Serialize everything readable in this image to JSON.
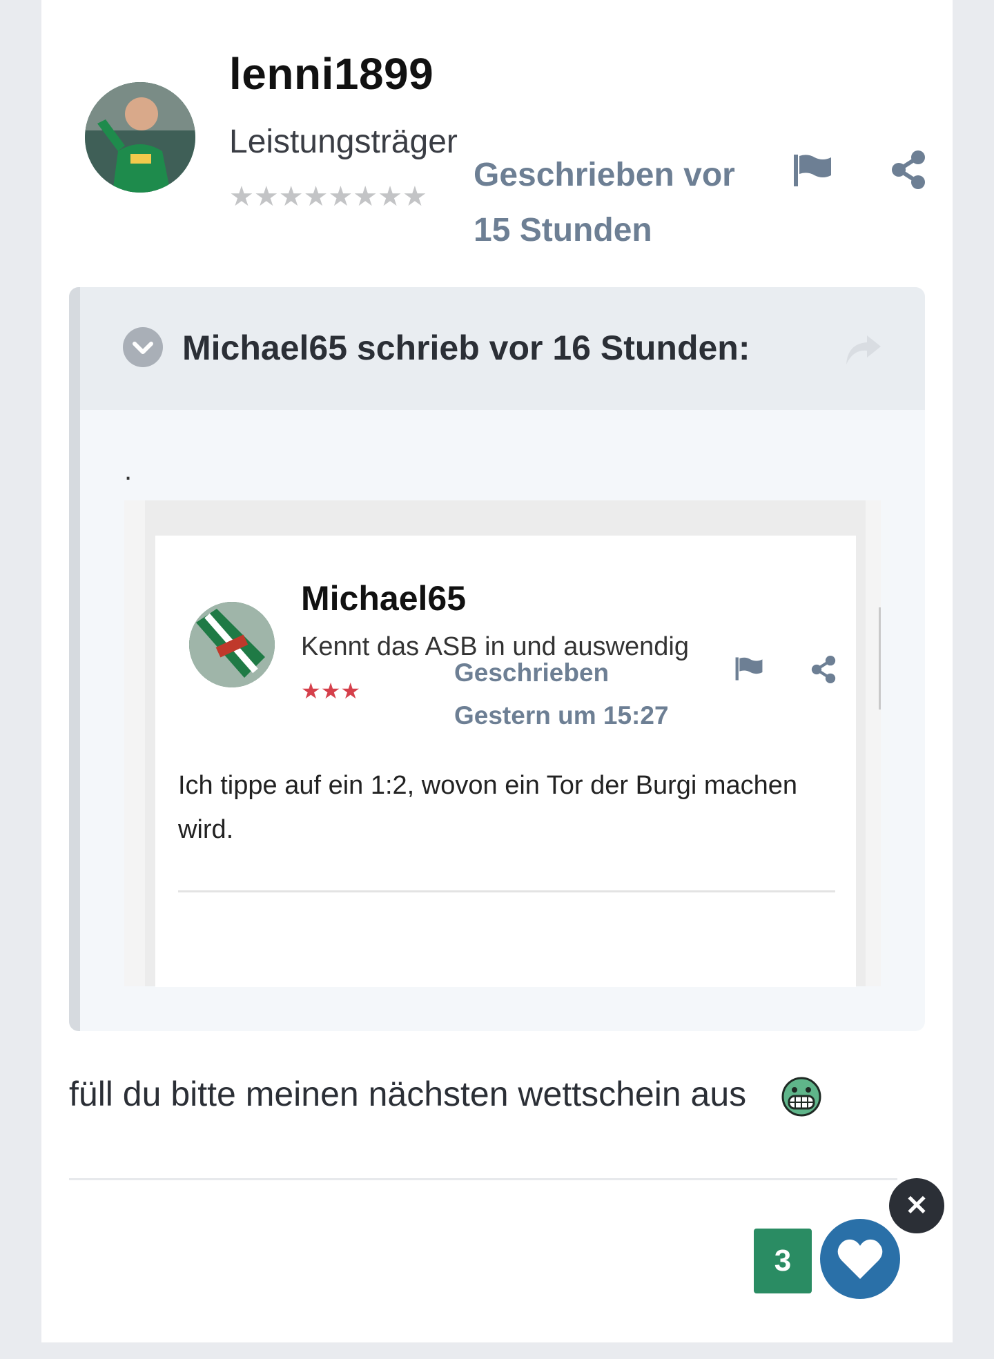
{
  "post": {
    "author": "lenni1899",
    "rank": "Leistungsträger",
    "rank_stars": "★★★★★★★★",
    "posted_line1": "Geschrieben vor",
    "posted_line2": "15 Stunden",
    "icons": {
      "report": "flag-icon",
      "share": "share-icon"
    }
  },
  "quote": {
    "header": "Michael65 schrieb vor 16 Stunden:",
    "icons": {
      "collapse": "chevron-down-icon",
      "go_to": "reply-arrow-icon"
    },
    "leading_text": ".",
    "screenshot": {
      "author": "Michael65",
      "rank": "Kennt das ASB in und auswendig",
      "rank_stars": "★★★",
      "posted_line1": "Geschrieben",
      "posted_line2": "Gestern um 15:27",
      "body": "Ich tippe auf ein 1:2, wovon ein Tor der Burgi machen wird."
    }
  },
  "message": {
    "text": "füll du bitte meinen nächsten wettschein aus",
    "emoji": "grinning-face-icon"
  },
  "reactions": {
    "count": "3",
    "close_symbol": "✕",
    "like_icon": "heart-icon"
  },
  "colors": {
    "meta": "#6d7f94",
    "reaction_count": "#2a8c63",
    "like_button": "#2a70a8",
    "close_button": "#2b2f36",
    "inner_stars": "#d5404b"
  }
}
